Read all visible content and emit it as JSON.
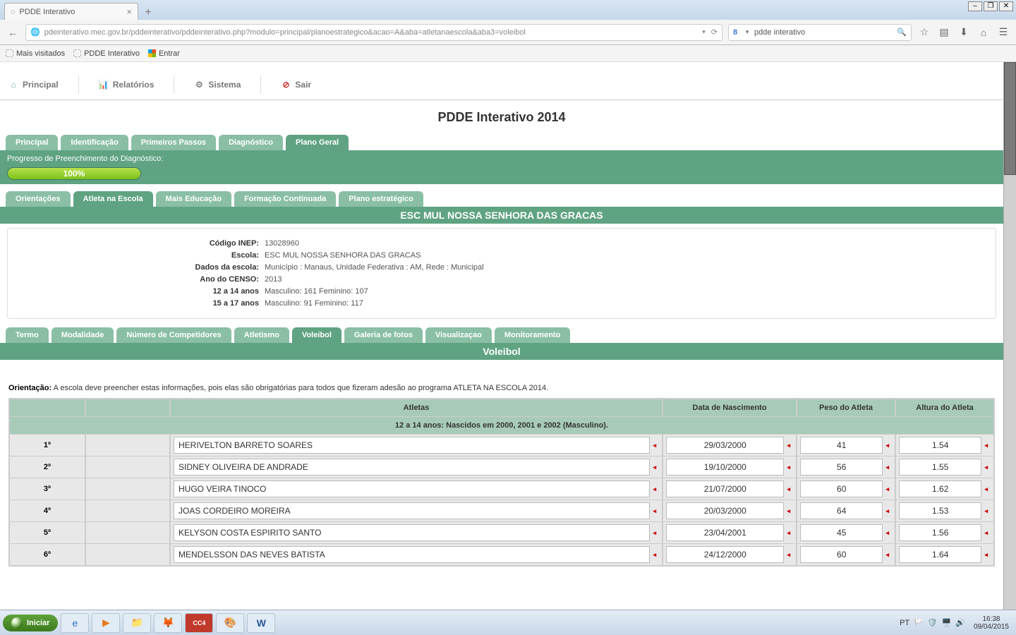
{
  "browser": {
    "tab_title": "PDDE Interativo",
    "url": "pdeinterativo.mec.gov.br/pddeinterativo/pddeinterativo.php?modulo=principal/planoestrategico&acao=A&aba=atletanaescola&aba3=voleibol",
    "search_engine_short": "8",
    "search_query": "pdde interativo",
    "bookmarks": {
      "b1": "Mais visitados",
      "b2": "PDDE Interativo",
      "b3": "Entrar"
    }
  },
  "appnav": {
    "principal": "Principal",
    "relatorios": "Relatórios",
    "sistema": "Sistema",
    "sair": "Sair"
  },
  "page_title": "PDDE Interativo 2014",
  "tabs1": {
    "t0": "Principal",
    "t1": "Identificação",
    "t2": "Primeiros Passos",
    "t3": "Diagnóstico",
    "t4": "Plano Geral"
  },
  "progress": {
    "label": "Progresso de Preenchimento do Diagnóstico:",
    "pct": "100%"
  },
  "tabs2": {
    "t0": "Orientações",
    "t1": "Atleta na Escola",
    "t2": "Mais Educação",
    "t3": "Formação Continuada",
    "t4": "Plano estratégico"
  },
  "school_banner": "ESC MUL NOSSA SENHORA DAS GRACAS",
  "info": {
    "l0": "Código INEP:",
    "v0": "13028960",
    "l1": "Escola:",
    "v1": "ESC MUL NOSSA SENHORA DAS GRACAS",
    "l2": "Dados da escola:",
    "v2": "Município : Manaus, Unidade Federativa : AM, Rede : Municipal",
    "l3": "Ano do CENSO:",
    "v3": "2013",
    "l4": "12 a 14 anos",
    "v4": "Masculino: 161 Feminino: 107",
    "l5": "15 a 17 anos",
    "v5": "Masculino: 91 Feminino: 117"
  },
  "tabs3": {
    "t0": "Termo",
    "t1": "Modalidade",
    "t2": "Número de Competidores",
    "t3": "Atletismo",
    "t4": "Voleibol",
    "t5": "Galeria de fotos",
    "t6": "Visualizaçao",
    "t7": "Monitoramento"
  },
  "sport_banner": "Voleibol",
  "orientation_label": "Orientação:",
  "orientation_text": "A escola deve preencher estas informações, pois elas são obrigatórias para todos que fizeram adesão ao programa ATLETA NA ESCOLA 2014.",
  "athlete_headers": {
    "atletas": "Atletas",
    "dob": "Data de Nascimento",
    "peso": "Peso do Atleta",
    "altura": "Altura do Atleta"
  },
  "sub_header": "12 a 14 anos: Nascidos em 2000, 2001 e 2002 (Masculino).",
  "rows": [
    {
      "n": "1º",
      "name": "HERIVELTON BARRETO SOARES",
      "dob": "29/03/2000",
      "peso": "41",
      "alt": "1.54"
    },
    {
      "n": "2º",
      "name": "SIDNEY OLIVEIRA DE ANDRADE",
      "dob": "19/10/2000",
      "peso": "56",
      "alt": "1.55"
    },
    {
      "n": "3º",
      "name": "HUGO VEIRA TINOCO",
      "dob": "21/07/2000",
      "peso": "60",
      "alt": "1.62"
    },
    {
      "n": "4º",
      "name": "JOAS CORDEIRO MOREIRA",
      "dob": "20/03/2000",
      "peso": "64",
      "alt": "1.53"
    },
    {
      "n": "5º",
      "name": "KELYSON COSTA ESPIRITO SANTO",
      "dob": "23/04/2001",
      "peso": "45",
      "alt": "1.56"
    },
    {
      "n": "6º",
      "name": "MENDELSSON DAS NEVES BATISTA",
      "dob": "24/12/2000",
      "peso": "60",
      "alt": "1.64"
    }
  ],
  "taskbar": {
    "start": "Iniciar",
    "lang": "PT",
    "time": "16:38",
    "date": "09/04/2015"
  }
}
